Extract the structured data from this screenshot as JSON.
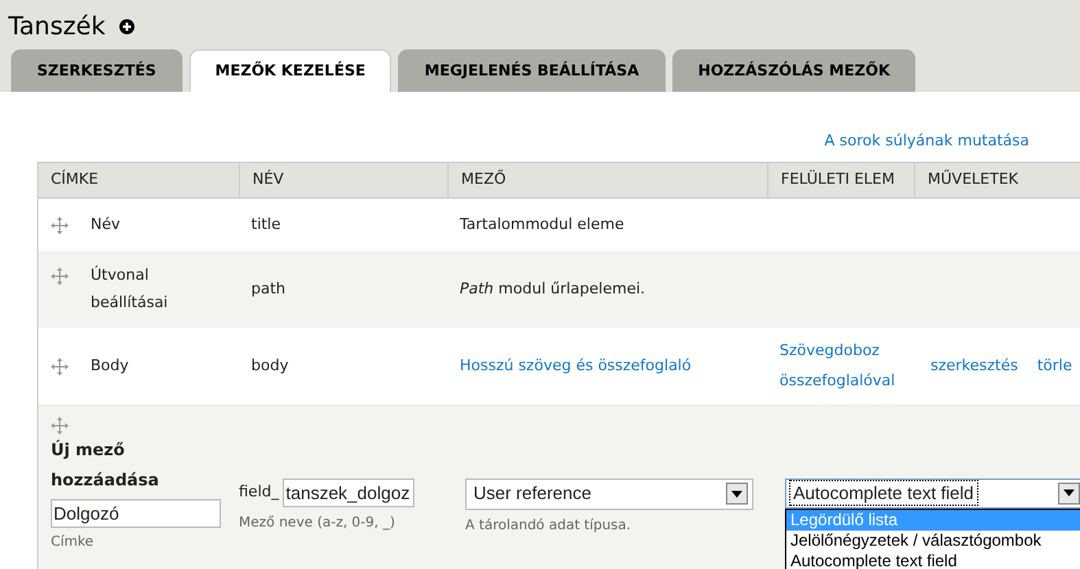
{
  "page_title": "Tanszék",
  "tabs": [
    {
      "label": "SZERKESZTÉS",
      "selected": false
    },
    {
      "label": "MEZŐK KEZELÉSE",
      "selected": true
    },
    {
      "label": "MEGJELENÉS BEÁLLÍTÁSA",
      "selected": false
    },
    {
      "label": "HOZZÁSZÓLÁS MEZŐK",
      "selected": false
    }
  ],
  "weights_link": "A sorok súlyának mutatása",
  "table": {
    "columns": [
      "CÍMKE",
      "NÉV",
      "MEZŐ",
      "FELÜLETI ELEM",
      "MŰVELETEK"
    ],
    "rows": [
      {
        "label": "Név",
        "name": "title",
        "field": {
          "text": "Tartalommodul eleme",
          "kind": "text"
        }
      },
      {
        "label": "Útvonal beállításai",
        "name": "path",
        "field": {
          "text": "*Path* modul űrlapelemei.",
          "kind": "text"
        }
      },
      {
        "label": "Body",
        "name": "body",
        "field": {
          "text": "Hosszú szöveg és összefoglaló",
          "kind": "link"
        },
        "widget": "Szövegdoboz összefoglalóval",
        "operations": [
          "szerkesztés",
          "törle"
        ]
      }
    ],
    "new_field": {
      "title": "Új mező hozzáadása",
      "label_value": "Dolgozó",
      "label_hint": "Címke",
      "name_prefix": "field_",
      "name_value": "tanszek_dolgoz",
      "name_hint": "Mező neve (a-z, 0-9, _)",
      "type_value": "User reference",
      "type_hint": "A tárolandó adat típusa.",
      "widget_value": "Autocomplete text field",
      "widget_options": [
        {
          "label": "Legördülő lista",
          "selected": true
        },
        {
          "label": "Jelölőnégyzetek / választógombok",
          "selected": false
        },
        {
          "label": "Autocomplete text field",
          "selected": false
        }
      ]
    }
  }
}
